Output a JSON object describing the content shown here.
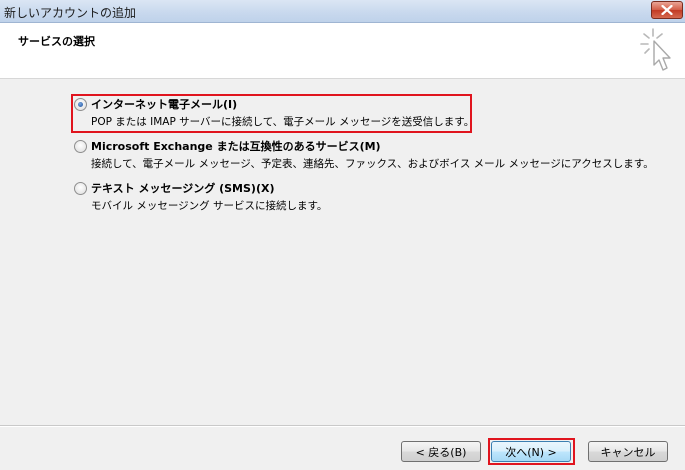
{
  "window": {
    "title": "新しいアカウントの追加"
  },
  "header": {
    "heading": "サービスの選択"
  },
  "options": [
    {
      "label": "インターネット電子メール(I)",
      "description": "POP または IMAP サーバーに接続して、電子メール メッセージを送受信します。",
      "selected": true
    },
    {
      "label": "Microsoft Exchange または互換性のあるサービス(M)",
      "description": "接続して、電子メール メッセージ、予定表、連絡先、ファックス、およびボイス メール メッセージにアクセスします。",
      "selected": false
    },
    {
      "label": "テキスト メッセージング (SMS)(X)",
      "description": "モバイル メッセージング サービスに接続します。",
      "selected": false
    }
  ],
  "buttons": {
    "back": "< 戻る(B)",
    "next": "次へ(N) >",
    "cancel": "キャンセル"
  },
  "colors": {
    "highlight": "#e0141e",
    "close_button": "#c23a23"
  },
  "icons": {
    "close": "close-icon",
    "header": "cursor-sparkle-icon"
  }
}
